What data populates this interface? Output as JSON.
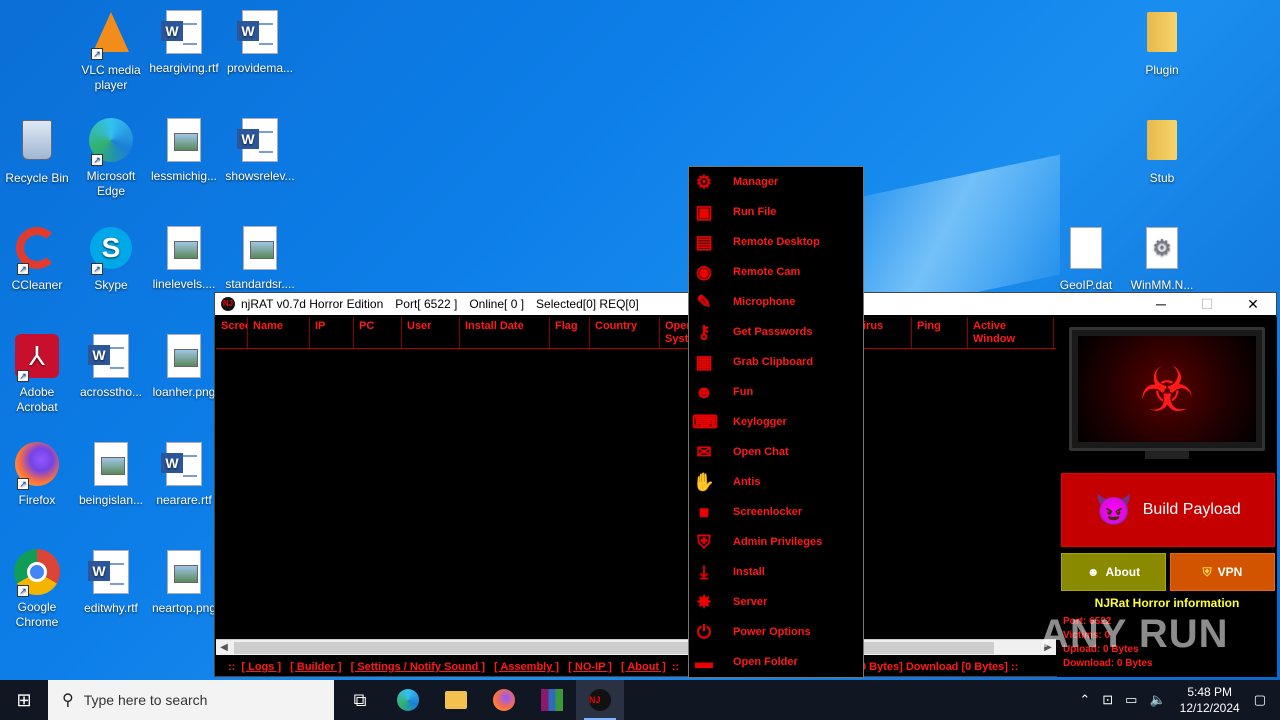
{
  "desktop": {
    "icons": [
      {
        "label": "VLC media player",
        "kind": "vlc"
      },
      {
        "label": "heargiving.rtf",
        "kind": "word"
      },
      {
        "label": "providema...",
        "kind": "word"
      },
      {
        "label": "Recycle Bin",
        "kind": "recycle"
      },
      {
        "label": "Microsoft Edge",
        "kind": "edge"
      },
      {
        "label": "lessmichig...",
        "kind": "image"
      },
      {
        "label": "showsrelev...",
        "kind": "word"
      },
      {
        "label": "CCleaner",
        "kind": "ccleaner"
      },
      {
        "label": "Skype",
        "kind": "skype"
      },
      {
        "label": "linelevels....",
        "kind": "image"
      },
      {
        "label": "standardsr....",
        "kind": "image"
      },
      {
        "label": "Adobe Acrobat",
        "kind": "acrobat"
      },
      {
        "label": "acrosstho...",
        "kind": "word"
      },
      {
        "label": "loanher.png",
        "kind": "image"
      },
      {
        "label": "Firefox",
        "kind": "firefox"
      },
      {
        "label": "beingislan...",
        "kind": "image"
      },
      {
        "label": "nearare.rtf",
        "kind": "word"
      },
      {
        "label": "Google Chrome",
        "kind": "chrome"
      },
      {
        "label": "editwhy.rtf",
        "kind": "word"
      },
      {
        "label": "neartop.png",
        "kind": "image"
      },
      {
        "label": "Plugin",
        "kind": "folder"
      },
      {
        "label": "Stub",
        "kind": "folder"
      },
      {
        "label": "GeoIP.dat",
        "kind": "blank"
      },
      {
        "label": "WinMM.N...",
        "kind": "gear"
      }
    ]
  },
  "window": {
    "title": "njRAT v0.7d Horror Edition",
    "port": "Port[ 6522 ]",
    "online": "Online[ 0 ]",
    "selected": "Selected[0] REQ[0]",
    "minimize": "─",
    "maximize": "☐",
    "close": "✕",
    "columns": [
      "Scree",
      "Name",
      "IP",
      "PC",
      "User",
      "Install Date",
      "Flag",
      "Country",
      "Oper Syste",
      "",
      "irus",
      "Ping",
      "Active Window"
    ],
    "bottom_links": [
      "[ Logs ]",
      "[ Builder ]",
      "[ Settings / Notify Sound ]",
      "[ Assembly ]",
      "[ NO-IP ]",
      "[ About ]"
    ],
    "bottom_prefix": "::",
    "bottom_sep": "::",
    "bottom_status": "0 Bytes]  Download [0 Bytes]  ::",
    "right_panel": {
      "build_label": "Build Payload",
      "about_label": "About",
      "vpn_label": "VPN",
      "info_title": "NJRat Horror information",
      "info_port": "Port: 6522",
      "info_victims": "Victims: 0",
      "info_upload": "Upload: 0 Bytes",
      "info_download": "Download: 0 Bytes"
    }
  },
  "context_menu": [
    {
      "label": "Manager",
      "icon": "gear-icon",
      "glyph": "⚙"
    },
    {
      "label": "Run File",
      "icon": "terminal-icon",
      "glyph": "▣"
    },
    {
      "label": "Remote Desktop",
      "icon": "desktop-icon",
      "glyph": "▤"
    },
    {
      "label": "Remote Cam",
      "icon": "webcam-icon",
      "glyph": "◉"
    },
    {
      "label": "Microphone",
      "icon": "microphone-icon",
      "glyph": "✎"
    },
    {
      "label": "Get Passwords",
      "icon": "key-icon",
      "glyph": "⚷"
    },
    {
      "label": "Grab Clipboard",
      "icon": "clipboard-icon",
      "glyph": "▦"
    },
    {
      "label": "Fun",
      "icon": "devil-face-icon",
      "glyph": "☻"
    },
    {
      "label": "Keylogger",
      "icon": "keyboard-icon",
      "glyph": "⌨"
    },
    {
      "label": "Open Chat",
      "icon": "chat-icon",
      "glyph": "✉"
    },
    {
      "label": "Antis",
      "icon": "hand-stop-icon",
      "glyph": "✋"
    },
    {
      "label": "Screenlocker",
      "icon": "lock-icon",
      "glyph": "■"
    },
    {
      "label": "Admin Privileges",
      "icon": "shield-icon",
      "glyph": "⛨"
    },
    {
      "label": "Install",
      "icon": "download-icon",
      "glyph": "⤓"
    },
    {
      "label": "Server",
      "icon": "bug-icon",
      "glyph": "✸"
    },
    {
      "label": "Power Options",
      "icon": "power-icon",
      "glyph": "⏻"
    },
    {
      "label": "Open Folder",
      "icon": "folder-icon",
      "glyph": "▬"
    }
  ],
  "watermark": "ANY RUN",
  "taskbar": {
    "search_placeholder": "Type here to search",
    "time": "5:48 PM",
    "date": "12/12/2024"
  }
}
